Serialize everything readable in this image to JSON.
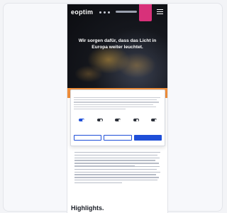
{
  "site": {
    "logo_text": "eoptim",
    "hero_title": "Wir sorgen dafür, dass das Licht in Europa weiter leuchtet.",
    "badge_text": ""
  },
  "cookie_banner": {
    "title": "",
    "logo": "",
    "toggles": [
      {
        "label": "",
        "state": "on"
      },
      {
        "label": "",
        "state": "off"
      },
      {
        "label": "",
        "state": "off"
      },
      {
        "label": "",
        "state": "off"
      },
      {
        "label": "",
        "state": "off"
      }
    ],
    "details_link": "",
    "buttons": {
      "deny": "",
      "save": "",
      "accept_all": ""
    }
  },
  "content": {
    "section_label": "",
    "section_title": "Highlights."
  },
  "colors": {
    "accent_orange": "#f07d19",
    "accent_blue": "#1f4fd8",
    "badge_pink": "#d8317a"
  }
}
